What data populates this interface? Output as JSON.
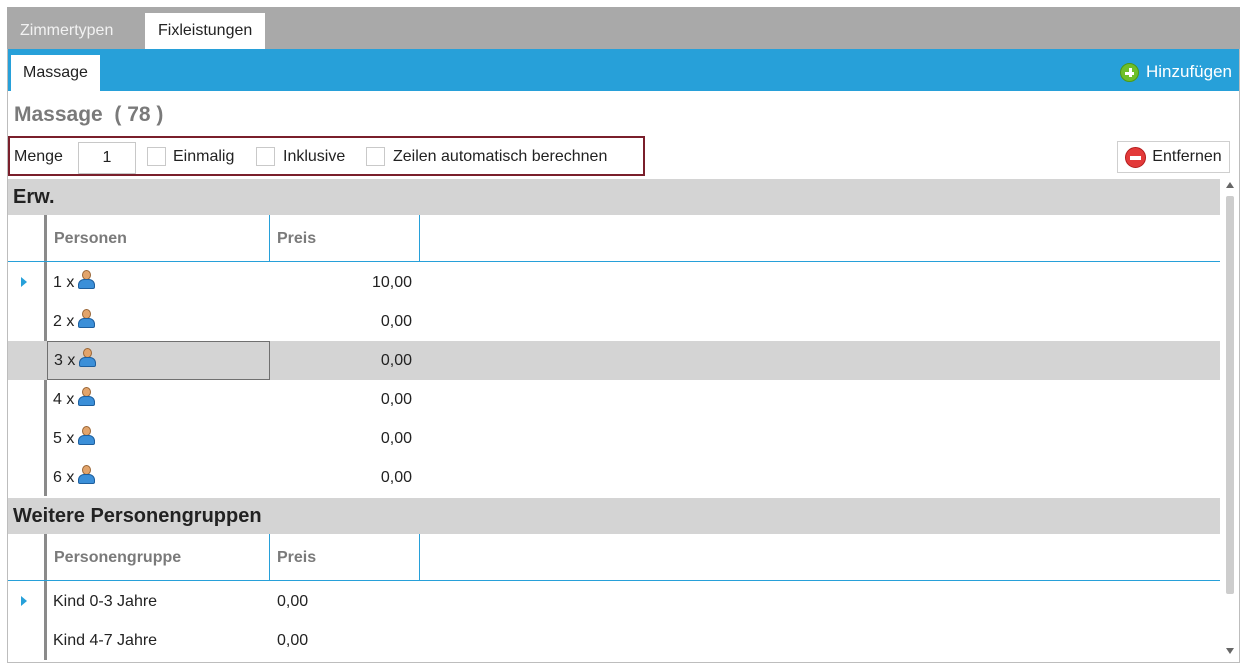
{
  "top_tabs": [
    {
      "label": "Zimmertypen",
      "active": false
    },
    {
      "label": "Fixleistungen",
      "active": true
    }
  ],
  "sub_tab": {
    "label": "Massage"
  },
  "toolbar": {
    "add_label": "Hinzufügen",
    "remove_label": "Entfernen"
  },
  "title": {
    "name": "Massage",
    "count": "( 78 )"
  },
  "options": {
    "quantity_label": "Menge",
    "quantity_value": "1",
    "once_label": "Einmalig",
    "once_checked": false,
    "inclusive_label": "Inklusive",
    "inclusive_checked": false,
    "auto_rows_label": "Zeilen automatisch berechnen",
    "auto_rows_checked": false
  },
  "adults": {
    "group_label": "Erw.",
    "columns": [
      "Personen",
      "Preis"
    ],
    "rows": [
      {
        "persons": "1 x",
        "price": "10,00",
        "current": true,
        "selected": false
      },
      {
        "persons": "2 x",
        "price": "0,00",
        "current": false,
        "selected": false
      },
      {
        "persons": "3 x",
        "price": "0,00",
        "current": false,
        "selected": true
      },
      {
        "persons": "4 x",
        "price": "0,00",
        "current": false,
        "selected": false
      },
      {
        "persons": "5 x",
        "price": "0,00",
        "current": false,
        "selected": false
      },
      {
        "persons": "6 x",
        "price": "0,00",
        "current": false,
        "selected": false
      }
    ]
  },
  "other_groups": {
    "group_label": "Weitere Personengruppen",
    "columns": [
      "Personengruppe",
      "Preis"
    ],
    "rows": [
      {
        "group": "Kind 0-3 Jahre",
        "price": "0,00",
        "current": true
      },
      {
        "group": "Kind 4-7 Jahre",
        "price": "0,00",
        "current": false
      }
    ]
  },
  "icons": {
    "person": "person-icon",
    "add": "plus-circle-icon",
    "remove": "minus-circle-icon"
  },
  "colors": {
    "accent": "#27a0d9",
    "tabbar": "#a9a9a9",
    "options_border": "#7a1f2b",
    "add_icon": "#6fbf2a",
    "remove_icon": "#e33a3a"
  }
}
